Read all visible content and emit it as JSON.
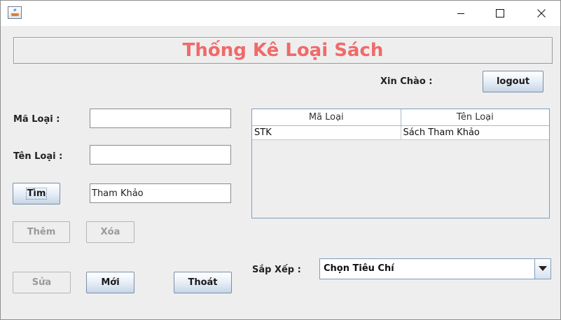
{
  "window": {
    "controls": {
      "minimize": "—",
      "maximize": "☐",
      "close": "✕"
    }
  },
  "header": {
    "title": "Thống Kê Loại Sách"
  },
  "greeting": {
    "label": "Xin Chào :"
  },
  "buttons": {
    "logout": "logout",
    "search": "Tìm",
    "add": "Thêm",
    "delete": "Xóa",
    "edit": "Sửa",
    "new": "Mới",
    "exit": "Thoát"
  },
  "form": {
    "ma_loai_label": "Mã Loại :",
    "ma_loai_value": "",
    "ten_loai_label": "Tên Loại :",
    "ten_loai_value": "",
    "search_value": "Tham Khảo"
  },
  "table": {
    "columns": [
      "Mã Loại",
      "Tên Loại"
    ],
    "rows": [
      [
        "STK",
        "Sách Tham Khảo"
      ]
    ]
  },
  "sort": {
    "label": "Sắp Xếp :",
    "selected": "Chọn Tiêu Chí"
  },
  "colors": {
    "title": "#f06a6a",
    "panel": "#eeeeee",
    "border_accent": "#7f9db9"
  }
}
